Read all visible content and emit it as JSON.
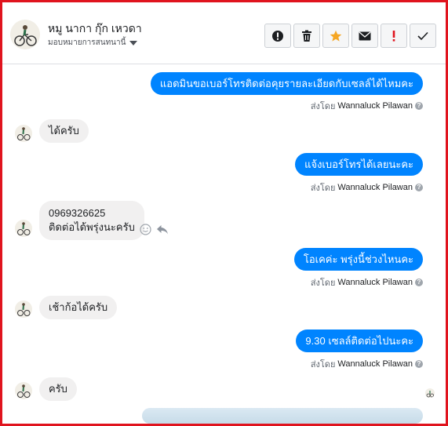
{
  "header": {
    "name": "หมู นากา กุ๊ก เหวดา",
    "assign_label": "มอบหมายการสนทนานี้",
    "tools": [
      {
        "icon": "alert-circle-icon",
        "label": "!"
      },
      {
        "icon": "trash-icon"
      },
      {
        "icon": "star-icon"
      },
      {
        "icon": "envelope-icon"
      },
      {
        "icon": "exclamation-icon",
        "label": "!"
      },
      {
        "icon": "check-icon"
      }
    ]
  },
  "messages": [
    {
      "dir": "out",
      "text": "แอดมินขอเบอร์โทรติดต่อคุยรายละเอียดกับเซลล์ได้ไหมคะ",
      "sent_prefix": "ส่งโดย",
      "sent_by": "Wannaluck Pilawan"
    },
    {
      "dir": "in",
      "text": "ได้ครับ"
    },
    {
      "dir": "out",
      "text": "แจ้งเบอร์โทรได้เลยนะคะ",
      "sent_prefix": "ส่งโดย",
      "sent_by": "Wannaluck Pilawan"
    },
    {
      "dir": "in",
      "lines": [
        "0969326625",
        "ติดต่อได้พรุ่งนะครับ"
      ]
    },
    {
      "dir": "out",
      "text": "โอเคค่ะ  พรุ่งนี้ช่วงไหนคะ",
      "sent_prefix": "ส่งโดย",
      "sent_by": "Wannaluck Pilawan"
    },
    {
      "dir": "in",
      "text": "เช้าก้อได้ครับ"
    },
    {
      "dir": "out",
      "text": "9.30 เซลล์ติดต่อไปนะคะ",
      "sent_prefix": "ส่งโดย",
      "sent_by": "Wannaluck Pilawan"
    },
    {
      "dir": "in",
      "text": "ครับ"
    }
  ],
  "colors": {
    "border": "#e0141e",
    "outgoing": "#0084ff",
    "incoming": "#f1f0f0",
    "star": "#f5a623",
    "alert": "#e0141e"
  }
}
